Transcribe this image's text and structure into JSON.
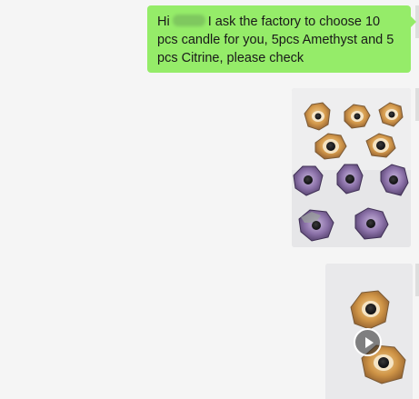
{
  "messages": [
    {
      "type": "text",
      "sender": "self",
      "greeting": "Hi",
      "text": "I ask the factory to choose 10 pcs candle for you, 5pcs Amethyst and 5 pcs Citrine, please check",
      "bubble_color": "#95ec69"
    },
    {
      "type": "image",
      "sender": "self",
      "subject": "crystal geode candle holders"
    },
    {
      "type": "video",
      "sender": "self",
      "icon": "play-icon"
    }
  ],
  "colors": {
    "background": "#f5f5f5",
    "bubble": "#95ec69",
    "citrine": "#c98a3a",
    "amethyst": "#6e5a86"
  }
}
